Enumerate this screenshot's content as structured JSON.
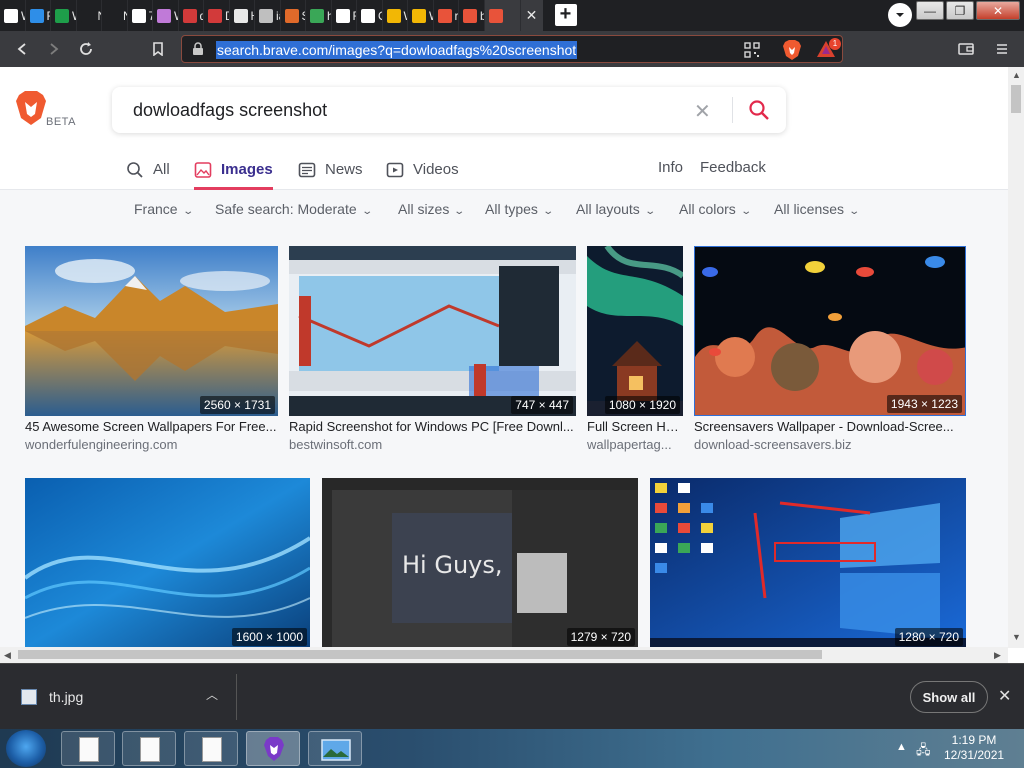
{
  "tabs": [
    {
      "icon": "wikipedia-icon",
      "title": "W",
      "color": "#ffffff"
    },
    {
      "icon": "edge-icon",
      "title": "Fr",
      "color": "#2e8ee8"
    },
    {
      "icon": "spreadsheet-icon",
      "title": "W",
      "color": "#1e9e4a"
    },
    {
      "icon": "blank-icon",
      "title": "New T",
      "color": "#1f2023"
    },
    {
      "icon": "blank-icon",
      "title": "New T",
      "color": "#1f2023"
    },
    {
      "icon": "7zip-icon",
      "title": "7-",
      "color": "#ffffff"
    },
    {
      "icon": "music-icon",
      "title": "W",
      "color": "#c07ad8"
    },
    {
      "icon": "red-box-icon",
      "title": "de",
      "color": "#d23a3a"
    },
    {
      "icon": "red-box-icon",
      "title": "D",
      "color": "#d23a3a"
    },
    {
      "icon": "document-icon",
      "title": "H",
      "color": "#e8e8e8"
    },
    {
      "icon": "globe-icon",
      "title": "ia",
      "color": "#bfbfbf"
    },
    {
      "icon": "swirl-icon",
      "title": "Sc",
      "color": "#e06a2a"
    },
    {
      "icon": "chrome-icon",
      "title": "ht",
      "color": "#3aa757"
    },
    {
      "icon": "github-icon",
      "title": "Re",
      "color": "#ffffff"
    },
    {
      "icon": "wix-icon",
      "title": "O",
      "color": "#ffffff"
    },
    {
      "icon": "w-icon",
      "title": "W",
      "color": "#f2b705"
    },
    {
      "icon": "w-icon",
      "title": "W",
      "color": "#f2b705"
    },
    {
      "icon": "brave-icon",
      "title": "re",
      "color": "#e8533a"
    },
    {
      "icon": "brave-icon",
      "title": "ba",
      "color": "#e8533a"
    },
    {
      "icon": "brave-icon",
      "title": "",
      "color": "#e8533a"
    }
  ],
  "browser": {
    "url": "search.brave.com/images?q=dowloadfags%20screenshot",
    "rewards_badge": "1"
  },
  "search": {
    "query": "dowloadfags screenshot",
    "beta_label": "BETA"
  },
  "nav": {
    "all": "All",
    "images": "Images",
    "news": "News",
    "videos": "Videos",
    "info": "Info",
    "feedback": "Feedback"
  },
  "filters": {
    "region": "France",
    "safe_search": "Safe search: Moderate",
    "sizes": "All sizes",
    "types": "All types",
    "layouts": "All layouts",
    "colors": "All colors",
    "licenses": "All licenses"
  },
  "results": [
    {
      "title": "45 Awesome Screen Wallpapers For Free...",
      "source": "wonderfulengineering.com",
      "dims": "2560 × 1731"
    },
    {
      "title": "Rapid Screenshot for Windows PC [Free Downl...",
      "source": "bestwinsoft.com",
      "dims": "747 × 447"
    },
    {
      "title": "Full Screen HD ...",
      "source": "wallpapertag...",
      "dims": "1080 × 1920"
    },
    {
      "title": "Screensavers Wallpaper - Download-Scree...",
      "source": "download-screensavers.biz",
      "dims": "1943 × 1223"
    },
    {
      "title": "",
      "source": "",
      "dims": "1600 × 1000"
    },
    {
      "title": "",
      "source": "",
      "dims": "1279 × 720",
      "overlay": "Hi Guys,"
    },
    {
      "title": "",
      "source": "",
      "dims": "1280 × 720"
    }
  ],
  "downloads": {
    "file": "th.jpg",
    "show_all": "Show all"
  },
  "taskbar": {
    "time": "1:19 PM",
    "date": "12/31/2021"
  }
}
